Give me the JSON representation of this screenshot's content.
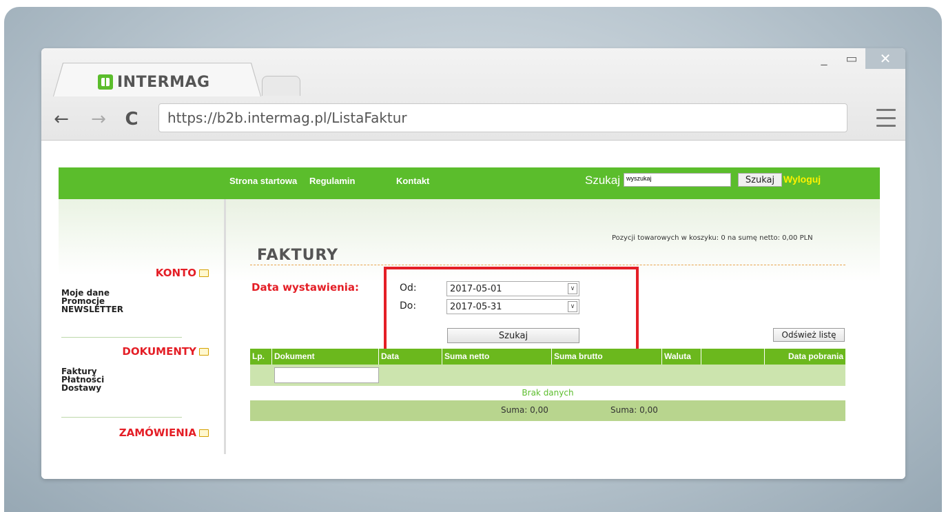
{
  "browser": {
    "tab_title": "INTERMAG",
    "url": "https://b2b.intermag.pl/ListaFaktur",
    "controls": {
      "minimize": "_",
      "maximize": "▭",
      "close": "✕"
    },
    "nav": {
      "back": "←",
      "forward": "→",
      "reload": "C"
    }
  },
  "topnav": {
    "links": [
      "Strona startowa",
      "Regulamin",
      "Kontakt"
    ],
    "search_label": "Szukaj",
    "search_placeholder": "wyszukaj",
    "search_button": "Szukaj",
    "logout": "Wyloguj"
  },
  "sidebar": {
    "sections": [
      {
        "title": "KONTO",
        "items": [
          "Moje dane",
          "Promocje",
          "NEWSLETTER"
        ]
      },
      {
        "title": "DOKUMENTY",
        "items": [
          "Faktury",
          "Płatności",
          "Dostawy"
        ]
      },
      {
        "title": "ZAMÓWIENIA",
        "items": []
      }
    ]
  },
  "cart_info": "Pozycji towarowych w koszyku: 0 na sumę netto: 0,00 PLN",
  "page_title": "FAKTURY",
  "filter": {
    "label": "Data wystawienia:",
    "from_label": "Od:",
    "from_value": "2017-05-01",
    "to_label": "Do:",
    "to_value": "2017-05-31",
    "search_button": "Szukaj"
  },
  "refresh_button": "Odśwież listę",
  "table": {
    "columns": [
      "Lp.",
      "Dokument",
      "Data",
      "Suma netto",
      "Suma brutto",
      "Waluta",
      "",
      "Data pobrania"
    ],
    "empty_text": "Brak danych",
    "sum_netto": "Suma: 0,00",
    "sum_brutto": "Suma: 0,00"
  },
  "colors": {
    "brand_green": "#5bbd2c",
    "accent_red": "#e41e26",
    "logout_yellow": "#fff200"
  }
}
